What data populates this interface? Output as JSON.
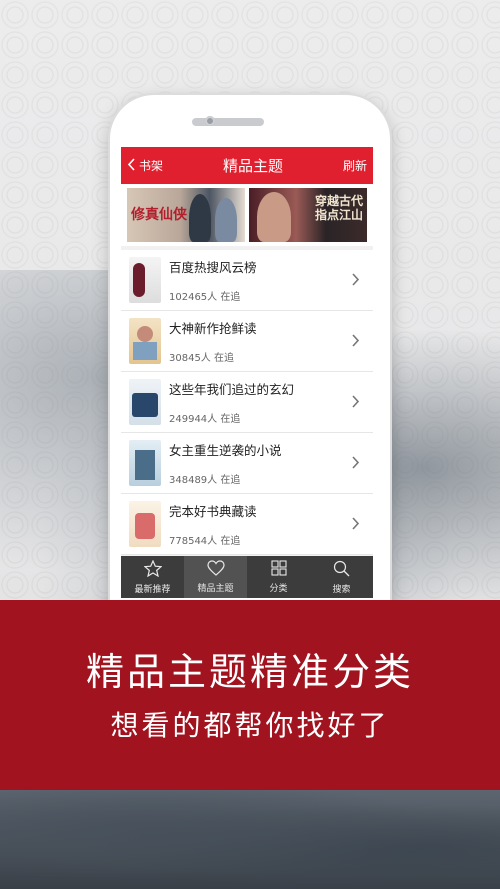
{
  "navbar": {
    "back_label": "书架",
    "title": "精品主题",
    "refresh_label": "刷新"
  },
  "banners": [
    {
      "text": "修真仙侠"
    },
    {
      "text_line1": "穿越古代",
      "text_line2": "指点江山"
    }
  ],
  "list": [
    {
      "title": "百度热搜风云榜",
      "count": "102465人 在追"
    },
    {
      "title": "大神新作抢鲜读",
      "count": "30845人 在追"
    },
    {
      "title": "这些年我们追过的玄幻",
      "count": "249944人 在追"
    },
    {
      "title": "女主重生逆袭的小说",
      "count": "348489人 在追"
    },
    {
      "title": "完本好书典藏读",
      "count": "778544人 在追"
    }
  ],
  "tabs": [
    {
      "label": "最新推荐",
      "icon": "star-icon"
    },
    {
      "label": "精品主题",
      "icon": "heart-icon"
    },
    {
      "label": "分类",
      "icon": "grid-icon"
    },
    {
      "label": "搜索",
      "icon": "search-icon"
    }
  ],
  "promo": {
    "headline": "精品主题精准分类",
    "subheadline": "想看的都帮你找好了"
  },
  "colors": {
    "accent": "#e0202f",
    "band": "#a0131f",
    "tabbar": "#3c3c3c"
  }
}
